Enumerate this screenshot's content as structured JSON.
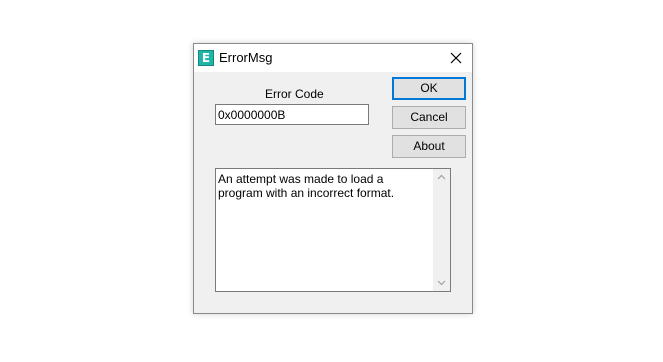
{
  "window": {
    "title": "ErrorMsg",
    "icon_letter": "E",
    "icon_name": "app-icon",
    "close_icon": "close-icon"
  },
  "form": {
    "error_code_label": "Error Code",
    "error_code_value": "0x0000000B",
    "message": "An attempt was made to load a program with an incorrect format."
  },
  "buttons": {
    "ok": "OK",
    "cancel": "Cancel",
    "about": "About"
  },
  "colors": {
    "icon_teal": "#1fb5a8",
    "default_button_border": "#0078d7",
    "dialog_background": "#f0f0f0"
  }
}
